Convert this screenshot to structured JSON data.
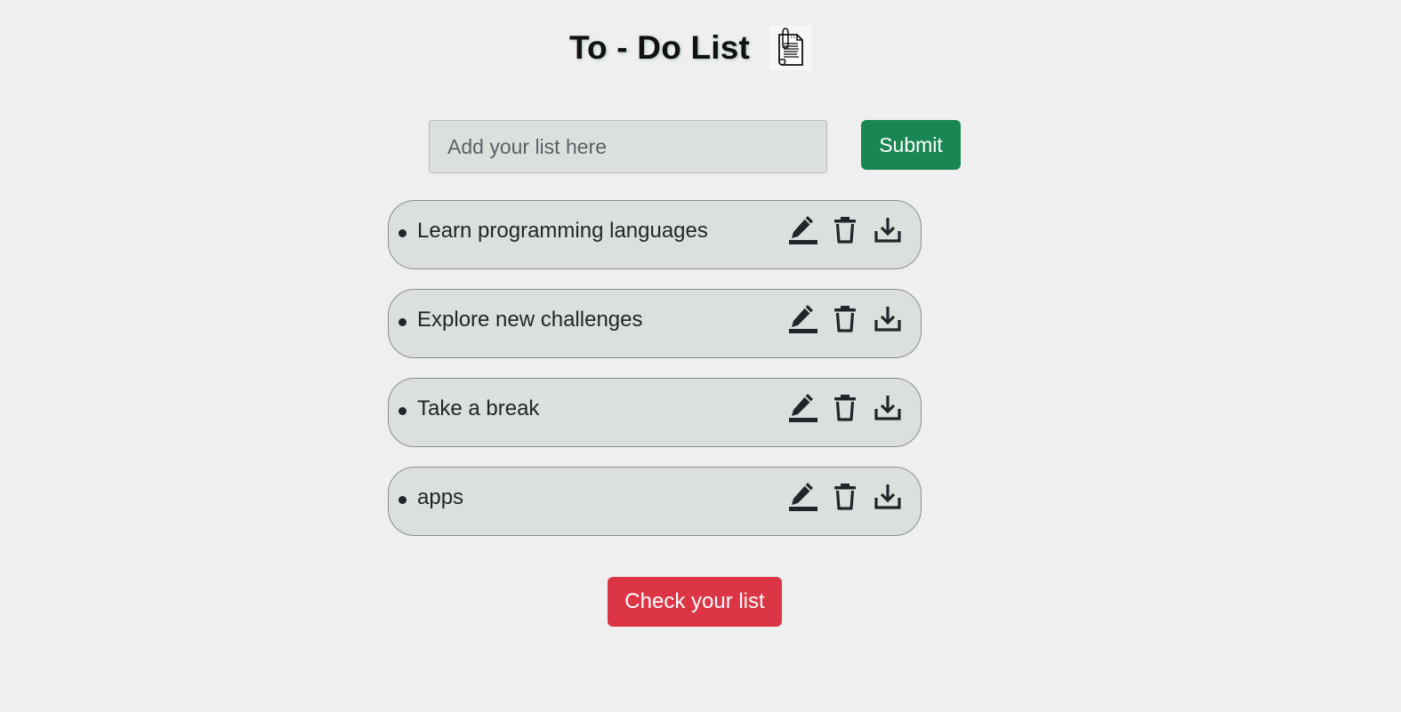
{
  "header": {
    "title": "To - Do List",
    "icon": "notepad-icon"
  },
  "form": {
    "placeholder": "Add your list here",
    "value": "",
    "submit_label": "Submit"
  },
  "todos": [
    {
      "text": "Learn programming languages"
    },
    {
      "text": "Explore new challenges"
    },
    {
      "text": "Take a break"
    },
    {
      "text": "apps"
    }
  ],
  "item_actions": [
    "pencil-icon",
    "trash-icon",
    "download-icon"
  ],
  "footer": {
    "check_label": "Check your list"
  },
  "colors": {
    "background": "#efefef",
    "field_background": "#dbe0de",
    "submit": "#198754",
    "check": "#dc3545",
    "text": "#212529"
  }
}
